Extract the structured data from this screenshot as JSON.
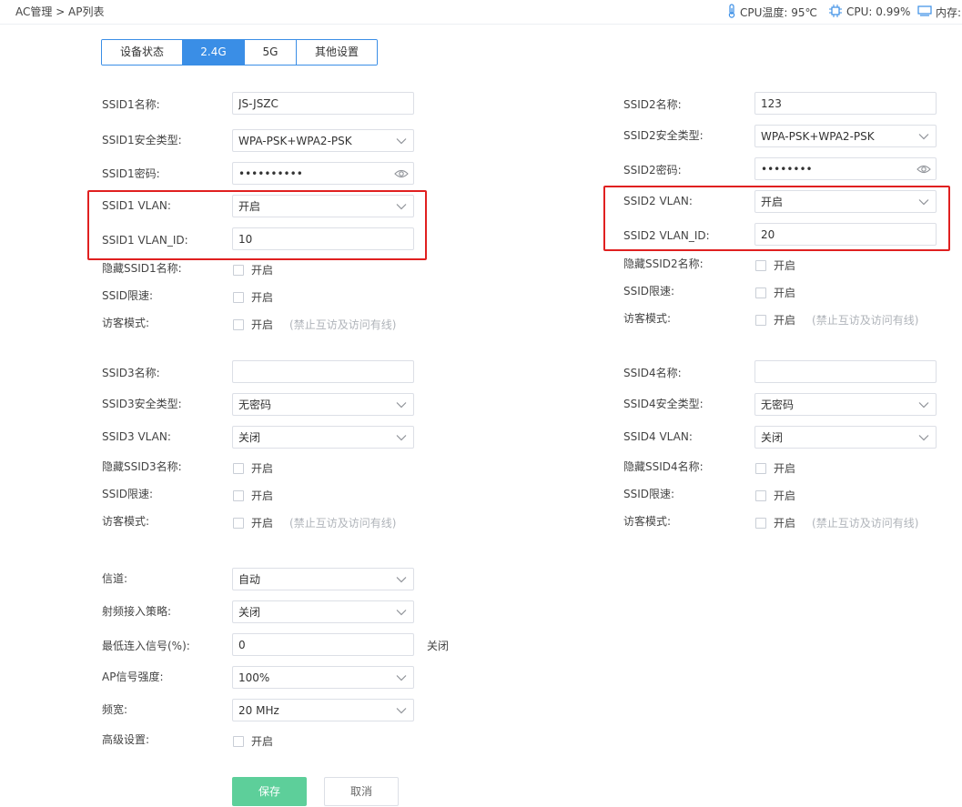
{
  "breadcrumb": "AC管理 > AP列表",
  "status": {
    "cpu_temp": "CPU温度: 95℃",
    "cpu_usage": "CPU: 0.99%",
    "memory": "内存:"
  },
  "tabs": [
    "设备状态",
    "2.4G",
    "5G",
    "其他设置"
  ],
  "active_tab": "2.4G",
  "common": {
    "enable": "开启",
    "guest_hint": "(禁止互访及访问有线)",
    "ssid_limit": "SSID限速:",
    "guest_mode": "访客模式:"
  },
  "ssid1": {
    "name_label": "SSID1名称:",
    "name_value": "JS-JSZC",
    "security_label": "SSID1安全类型:",
    "security_value": "WPA-PSK+WPA2-PSK",
    "password_label": "SSID1密码:",
    "password_value": "••••••••••",
    "vlan_label": "SSID1 VLAN:",
    "vlan_value": "开启",
    "vlan_id_label": "SSID1 VLAN_ID:",
    "vlan_id_value": "10",
    "hide_label": "隐藏SSID1名称:"
  },
  "ssid2": {
    "name_label": "SSID2名称:",
    "name_value": "123",
    "security_label": "SSID2安全类型:",
    "security_value": "WPA-PSK+WPA2-PSK",
    "password_label": "SSID2密码:",
    "password_value": "••••••••",
    "vlan_label": "SSID2 VLAN:",
    "vlan_value": "开启",
    "vlan_id_label": "SSID2 VLAN_ID:",
    "vlan_id_value": "20",
    "hide_label": "隐藏SSID2名称:"
  },
  "ssid3": {
    "name_label": "SSID3名称:",
    "name_value": "",
    "security_label": "SSID3安全类型:",
    "security_value": "无密码",
    "vlan_label": "SSID3 VLAN:",
    "vlan_value": "关闭",
    "hide_label": "隐藏SSID3名称:"
  },
  "ssid4": {
    "name_label": "SSID4名称:",
    "name_value": "",
    "security_label": "SSID4安全类型:",
    "security_value": "无密码",
    "vlan_label": "SSID4 VLAN:",
    "vlan_value": "关闭",
    "hide_label": "隐藏SSID4名称:"
  },
  "radio": {
    "channel_label": "信道:",
    "channel_value": "自动",
    "access_policy_label": "射频接入策略:",
    "access_policy_value": "关闭",
    "min_signal_label": "最低连入信号(%):",
    "min_signal_value": "0",
    "min_signal_status": "关闭",
    "power_label": "AP信号强度:",
    "power_value": "100%",
    "bandwidth_label": "频宽:",
    "bandwidth_value": "20 MHz",
    "advanced_label": "高级设置:"
  },
  "actions": {
    "save": "保存",
    "cancel": "取消"
  },
  "colors": {
    "accent": "#3a8ee6",
    "save": "#5dcf9a",
    "highlight": "#e02020"
  }
}
